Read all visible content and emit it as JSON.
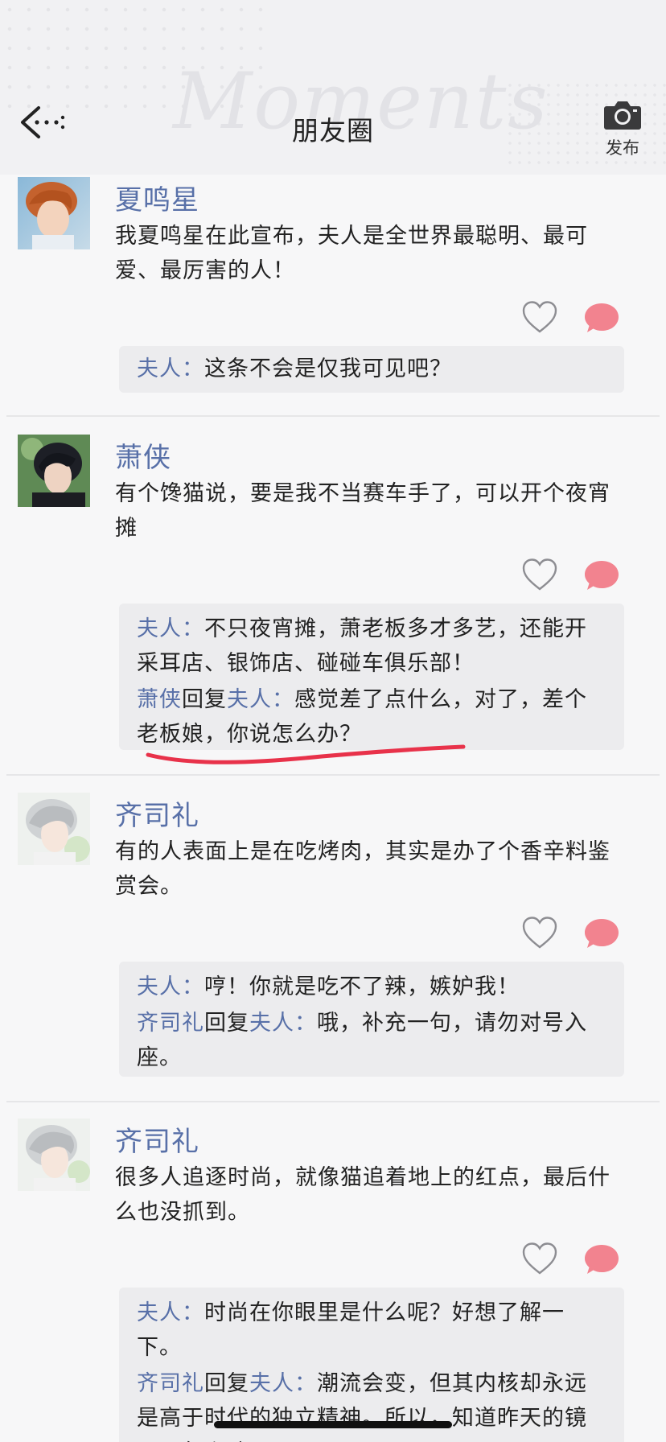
{
  "header": {
    "title": "朋友圈",
    "watermark": "Moments",
    "publish_label": "发布"
  },
  "posts": [
    {
      "author": "夏鸣星",
      "text": "我夏鸣星在此宣布，夫人是全世界最聪明、最可爱、最厉害的人！",
      "replies": [
        {
          "from": "夫人",
          "to": "",
          "text": "这条不会是仅我可见吧？"
        }
      ]
    },
    {
      "author": "萧侠",
      "text": "有个馋猫说，要是我不当赛车手了，可以开个夜宵摊",
      "replies": [
        {
          "from": "夫人",
          "to": "",
          "text": "不只夜宵摊，萧老板多才多艺，还能开采耳店、银饰店、碰碰车俱乐部！"
        },
        {
          "from": "萧侠",
          "reply_word": "回复",
          "to": "夫人",
          "text": "感觉差了点什么，对了，差个老板娘，你说怎么办？"
        }
      ]
    },
    {
      "author": "齐司礼",
      "text": "有的人表面上是在吃烤肉，其实是办了个香辛料鉴赏会。",
      "replies": [
        {
          "from": "夫人",
          "to": "",
          "text": "哼！你就是吃不了辣，嫉妒我！"
        },
        {
          "from": "齐司礼",
          "reply_word": "回复",
          "to": "夫人",
          "text": "哦，补充一句，请勿对号入座。"
        }
      ]
    },
    {
      "author": "齐司礼",
      "text": "很多人追逐时尚，就像猫追着地上的红点，最后什么也没抓到。",
      "replies": [
        {
          "from": "夫人",
          "to": "",
          "text": "时尚在你眼里是什么呢？好想了解一下。"
        },
        {
          "from": "齐司礼",
          "reply_word": "回复",
          "to": "夫人",
          "text": "潮流会变，但其内核却永远是高于时代的独立精神。所以，知道昨天的镜子要怎么改了吗？"
        }
      ]
    }
  ],
  "colors": {
    "name": "#5870a8",
    "comment_icon": "#f2838f",
    "annotation": "#e8324a"
  },
  "icons": [
    "back-arrow-icon",
    "camera-icon",
    "heart-icon",
    "comment-icon"
  ]
}
